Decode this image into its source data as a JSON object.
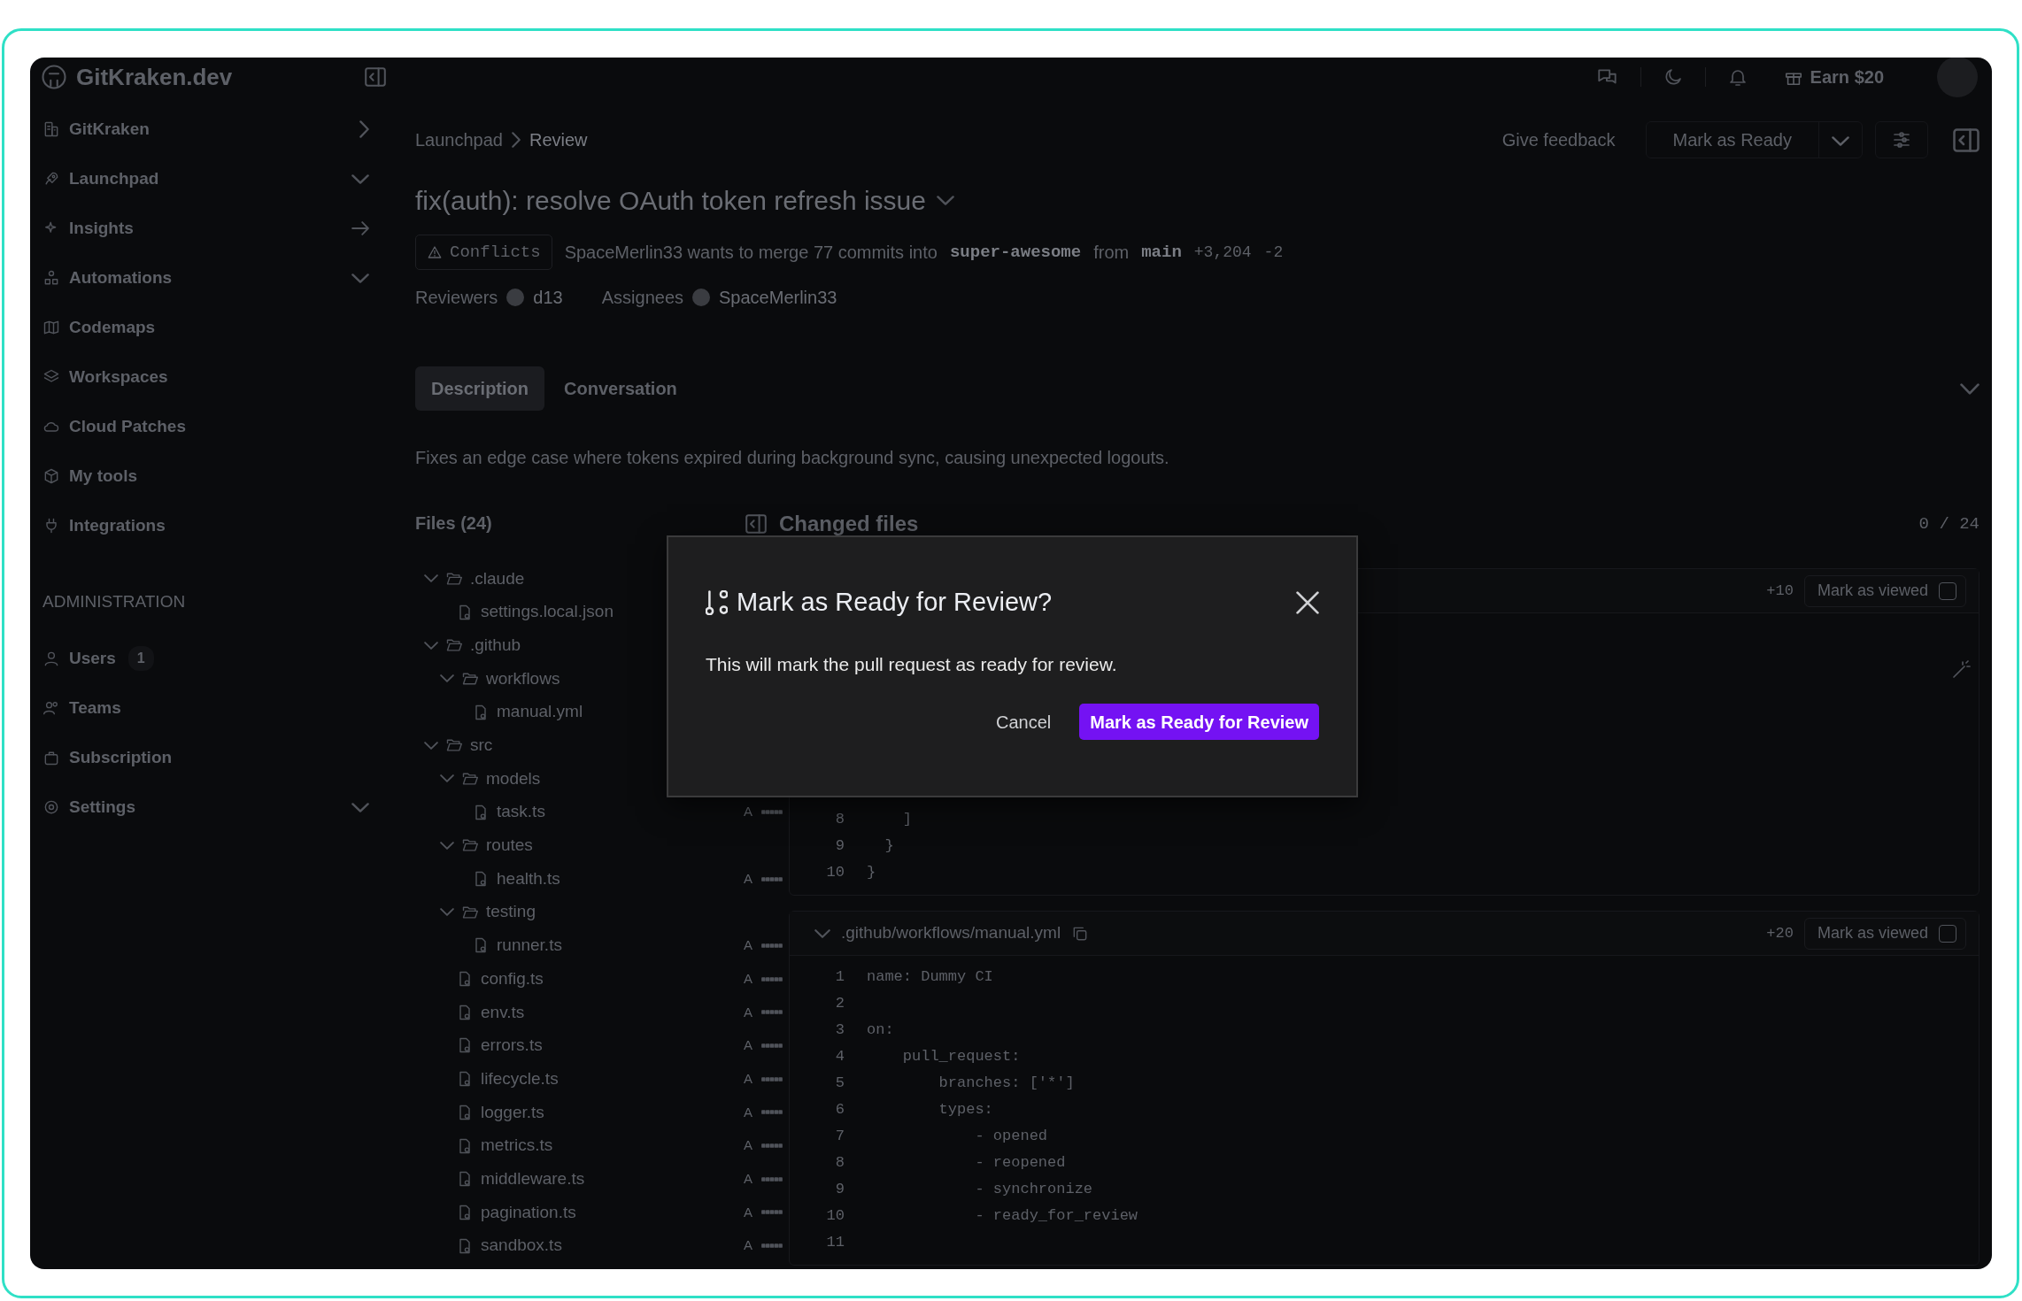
{
  "app": {
    "brand": "GitKraken.dev"
  },
  "topbar": {
    "reward": "Earn $20"
  },
  "sidebar": {
    "items": [
      {
        "label": "GitKraken",
        "kind": "submenu"
      },
      {
        "label": "Launchpad",
        "kind": "group"
      },
      {
        "label": "Insights",
        "kind": "external"
      },
      {
        "label": "Automations",
        "kind": "group"
      },
      {
        "label": "Codemaps",
        "kind": "plain"
      },
      {
        "label": "Workspaces",
        "kind": "plain"
      },
      {
        "label": "Cloud Patches",
        "kind": "plain"
      },
      {
        "label": "My tools",
        "kind": "plain"
      },
      {
        "label": "Integrations",
        "kind": "plain"
      }
    ],
    "section_title": "ADMINISTRATION",
    "admin_items": [
      {
        "label": "Users",
        "badge": "1",
        "kind": "plain"
      },
      {
        "label": "Teams",
        "kind": "plain"
      },
      {
        "label": "Subscription",
        "kind": "plain"
      },
      {
        "label": "Settings",
        "kind": "group"
      }
    ]
  },
  "breadcrumb": [
    {
      "label": "Launchpad",
      "current": false
    },
    {
      "label": "Review",
      "current": true
    }
  ],
  "actions": {
    "feedback": "Give feedback",
    "primary": "Mark as Ready"
  },
  "pull_request": {
    "title": "fix(auth): resolve OAuth token refresh issue",
    "status": "Conflicts",
    "summary": "SpaceMerlin33 wants to merge 77 commits into",
    "target_branch": "super-awesome",
    "joiner": "from",
    "source_branch": "main",
    "additions": "+3,204",
    "deletions": "-2",
    "reviewers_label": "Reviewers",
    "reviewer": "d13",
    "assignees_label": "Assignees",
    "assignee": "SpaceMerlin33"
  },
  "tabs": [
    {
      "label": "Description",
      "selected": true
    },
    {
      "label": "Conversation",
      "selected": false
    }
  ],
  "description": "Fixes an edge case where tokens expired during background sync, causing unexpected logouts.",
  "files": {
    "title": "Files (24)",
    "tree": [
      {
        "name": ".claude",
        "kind": "folder",
        "expanded": true,
        "children": [
          {
            "name": "settings.local.json",
            "kind": "file"
          }
        ]
      },
      {
        "name": ".github",
        "kind": "folder",
        "expanded": true,
        "children": [
          {
            "name": "workflows",
            "kind": "folder",
            "expanded": true,
            "children": [
              {
                "name": "manual.yml",
                "kind": "file"
              }
            ]
          }
        ]
      },
      {
        "name": "src",
        "kind": "folder",
        "expanded": true,
        "children": [
          {
            "name": "models",
            "kind": "folder",
            "expanded": true,
            "children": [
              {
                "name": "task.ts",
                "kind": "file",
                "status": "A"
              }
            ]
          },
          {
            "name": "routes",
            "kind": "folder",
            "expanded": true,
            "children": [
              {
                "name": "health.ts",
                "kind": "file",
                "status": "A"
              }
            ]
          },
          {
            "name": "testing",
            "kind": "folder",
            "expanded": true,
            "children": [
              {
                "name": "runner.ts",
                "kind": "file",
                "status": "A"
              }
            ]
          },
          {
            "name": "config.ts",
            "kind": "file",
            "status": "A"
          },
          {
            "name": "env.ts",
            "kind": "file",
            "status": "A"
          },
          {
            "name": "errors.ts",
            "kind": "file",
            "status": "A"
          },
          {
            "name": "lifecycle.ts",
            "kind": "file",
            "status": "A"
          },
          {
            "name": "logger.ts",
            "kind": "file",
            "status": "A"
          },
          {
            "name": "metrics.ts",
            "kind": "file",
            "status": "A"
          },
          {
            "name": "middleware.ts",
            "kind": "file",
            "status": "A"
          },
          {
            "name": "pagination.ts",
            "kind": "file",
            "status": "A"
          },
          {
            "name": "sandbox.ts",
            "kind": "file",
            "status": "A"
          }
        ]
      }
    ]
  },
  "changed_files": {
    "title": "Changed files",
    "progress": "0 / 24",
    "diffs": [
      {
        "additions": "+10",
        "viewed_label": "Mark as viewed",
        "viewed": false,
        "lines": [
          {
            "n": "8",
            "code": "    ]"
          },
          {
            "n": "9",
            "code": "  }"
          },
          {
            "n": "10",
            "code": "}"
          }
        ]
      },
      {
        "path": ".github/workflows/manual.yml",
        "expanded": true,
        "additions": "+20",
        "viewed_label": "Mark as viewed",
        "viewed": false,
        "lines": [
          {
            "n": "1",
            "code": "name: Dummy CI"
          },
          {
            "n": "2"
          },
          {
            "n": "3",
            "code": "on:"
          },
          {
            "n": "4",
            "code": "    pull_request:"
          },
          {
            "n": "5",
            "code": "        branches: ['*']"
          },
          {
            "n": "6",
            "code": "        types:"
          },
          {
            "n": "7",
            "code": "            - opened"
          },
          {
            "n": "8",
            "code": "            - reopened"
          },
          {
            "n": "9",
            "code": "            - synchronize"
          },
          {
            "n": "10",
            "code": "            - ready_for_review"
          },
          {
            "n": "11"
          }
        ]
      }
    ]
  },
  "dialog": {
    "title": "Mark as Ready for Review?",
    "body": "This will mark the pull request as ready for review.",
    "cancel": "Cancel",
    "confirm": "Mark as Ready for Review"
  }
}
